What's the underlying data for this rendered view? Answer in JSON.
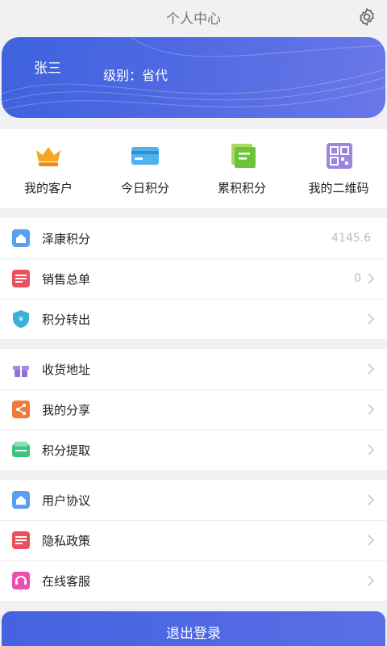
{
  "header": {
    "title": "个人中心",
    "settings_icon": "gear-icon"
  },
  "profile": {
    "name": "张三",
    "level": "级别：省代",
    "background": "#4a66e0"
  },
  "quick_actions": [
    {
      "label": "我的客户",
      "icon": "crown-icon"
    },
    {
      "label": "今日积分",
      "icon": "card-icon"
    },
    {
      "label": "累积积分",
      "icon": "stack-icon"
    },
    {
      "label": "我的二维码",
      "icon": "qr-code-icon"
    }
  ],
  "menu_group_1": [
    {
      "label": "泽康积分",
      "value": "4145.6",
      "icon": "points-icon"
    },
    {
      "label": "销售总单",
      "value": "0",
      "icon": "order-list-icon"
    },
    {
      "label": "积分转出",
      "value": "",
      "icon": "transfer-out-icon"
    }
  ],
  "menu_group_2": [
    {
      "label": "收货地址",
      "value": "",
      "icon": "gift-box-icon"
    },
    {
      "label": "我的分享",
      "value": "",
      "icon": "share-icon"
    },
    {
      "label": "积分提取",
      "value": "",
      "icon": "withdraw-icon"
    }
  ],
  "menu_group_3": [
    {
      "label": "用户协议",
      "value": "",
      "icon": "agreement-icon"
    },
    {
      "label": "隐私政策",
      "value": "",
      "icon": "privacy-icon"
    },
    {
      "label": "在线客服",
      "value": "",
      "icon": "customer-service-icon"
    }
  ],
  "logout": {
    "label": "退出登录"
  },
  "colors": {
    "accent": "#4562e0",
    "page_background": "#f1f1f4"
  }
}
